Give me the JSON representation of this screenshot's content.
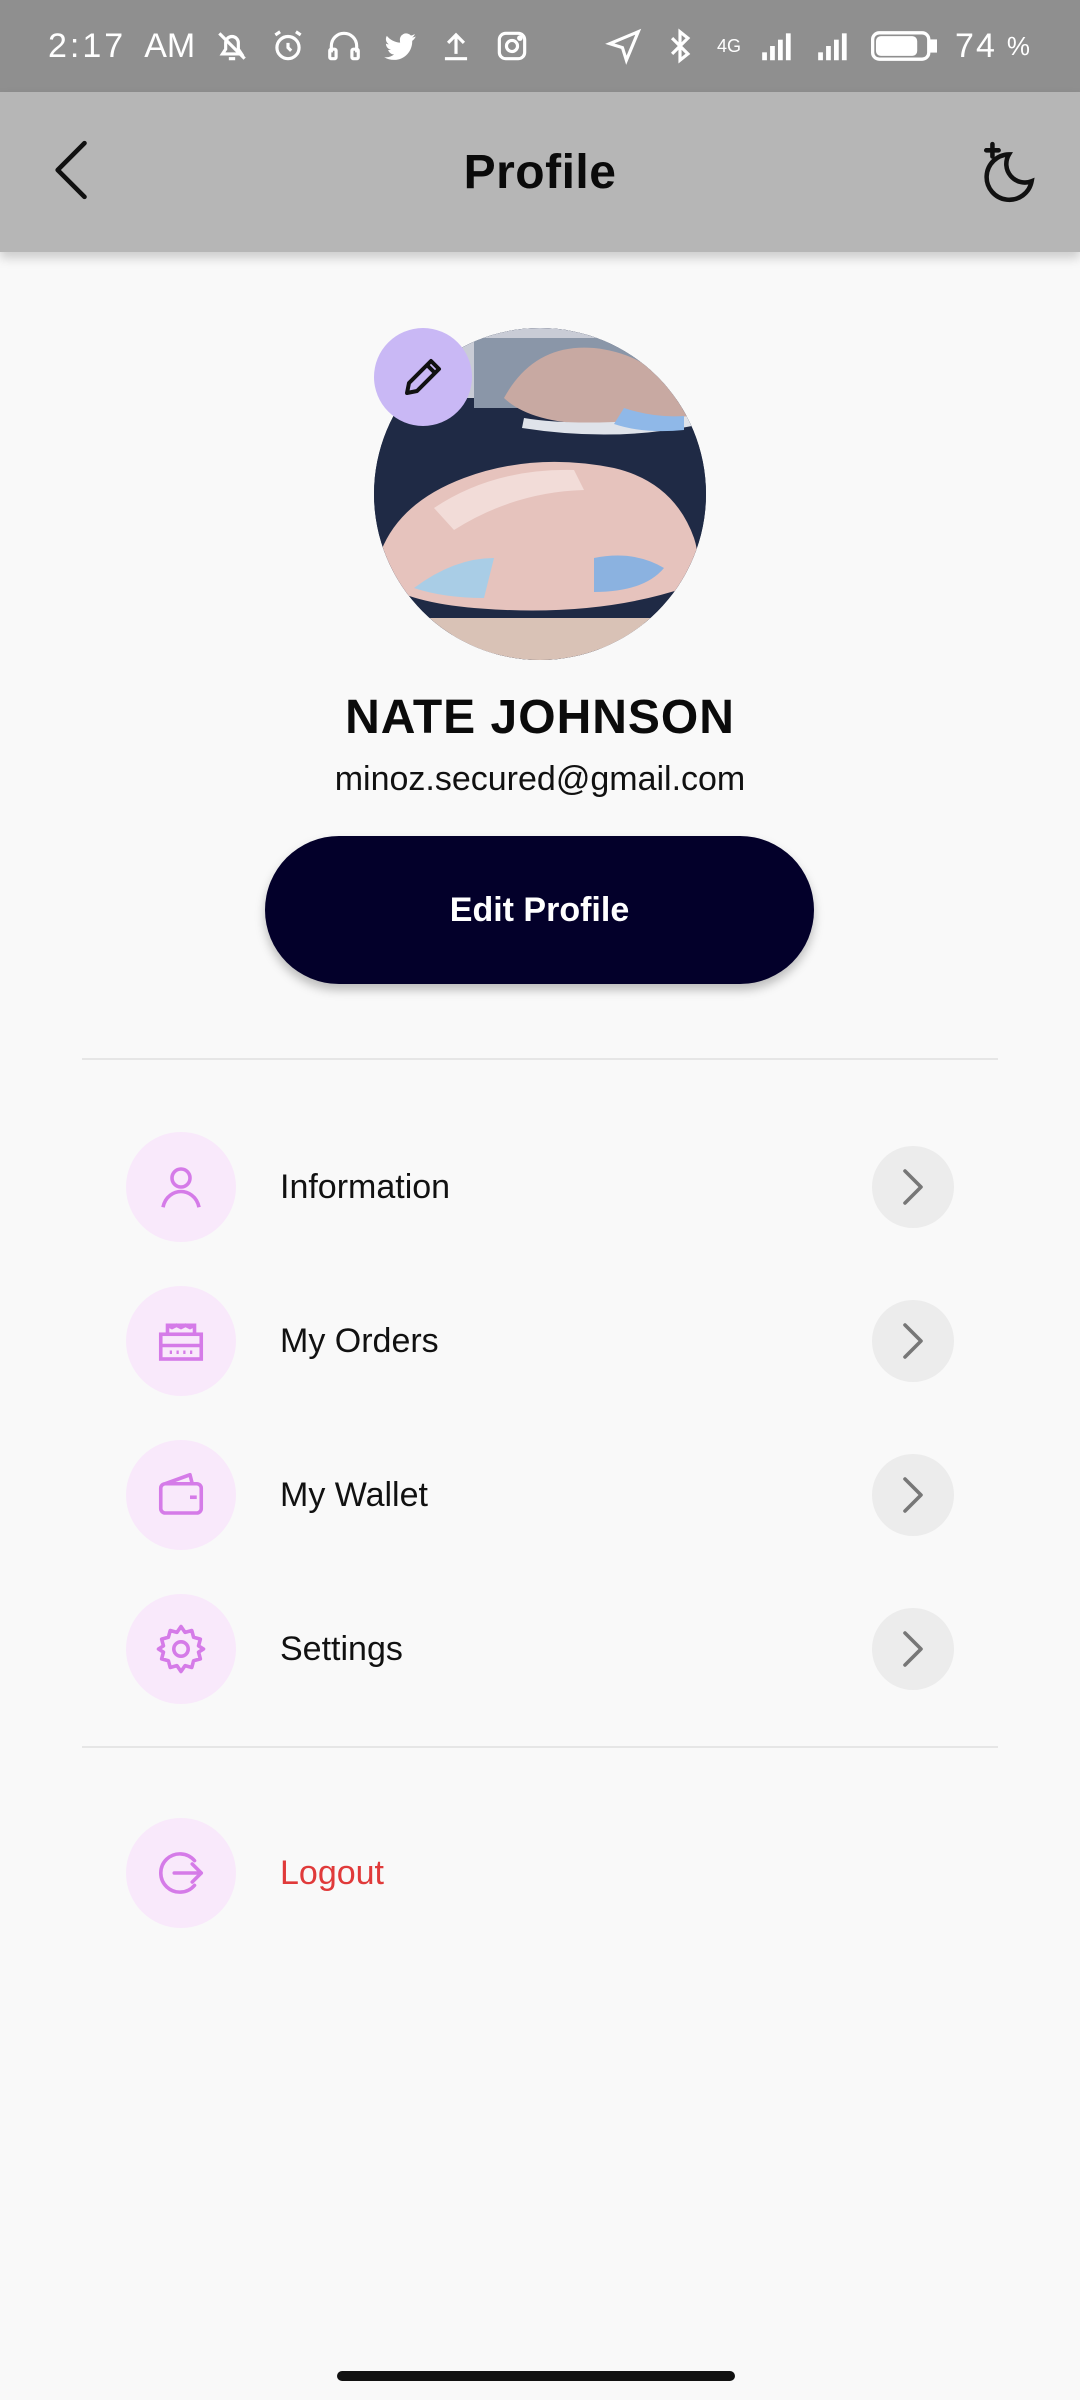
{
  "status_bar": {
    "time": "2:17",
    "am_pm": "AM",
    "network": "4G",
    "battery": "74",
    "battery_unit": "%"
  },
  "header": {
    "title": "Profile"
  },
  "profile": {
    "name": "NATE JOHNSON",
    "email": "minoz.secured@gmail.com",
    "edit_button_label": "Edit Profile"
  },
  "menu": {
    "items": [
      {
        "label": "Information",
        "icon": "user-icon"
      },
      {
        "label": "My Orders",
        "icon": "orders-icon"
      },
      {
        "label": "My Wallet",
        "icon": "wallet-icon"
      },
      {
        "label": "Settings",
        "icon": "gear-icon"
      }
    ],
    "logout": {
      "label": "Logout",
      "icon": "logout-icon"
    }
  },
  "colors": {
    "accent": "#d57be8",
    "button": "#03002a",
    "logout": "#e03a3a",
    "icon_bg": "#f9e9fb",
    "edit_badge": "#c9b8f5"
  }
}
